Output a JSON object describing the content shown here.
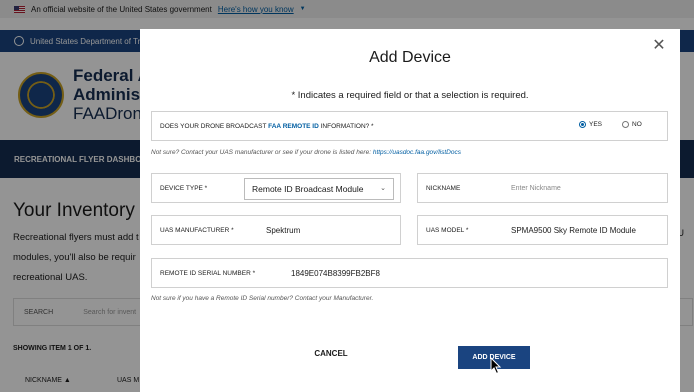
{
  "background": {
    "gov_banner": {
      "text": "An official website of the United States government",
      "link": "Here's how you know"
    },
    "agency_bar": "United States Department of Tra",
    "header": {
      "line1": "Federal Av",
      "line2": "Administrat",
      "line3": "FAADroneZ"
    },
    "dash_bar": "RECREATIONAL FLYER DASHBOAR",
    "inventory_title": "Your Inventory",
    "inventory_text": [
      "Recreational flyers must add t",
      "modules, you'll also be requir",
      "recreational UAS."
    ],
    "search_label": "SEARCH",
    "search_placeholder": "Search for invent",
    "showing": "SHOWING ITEM 1 OF 1.",
    "col_nickname": "NICKNAME",
    "col_uas": "UAS M",
    "right_fragments": [
      "t",
      "n U",
      "ed"
    ]
  },
  "modal": {
    "title": "Add Device",
    "close_icon": "close-icon",
    "required_note": "* Indicates a required field or that a selection is required.",
    "broadcast": {
      "label_before": "DOES YOUR DRONE BROADCAST ",
      "label_link": "FAA REMOTE ID",
      "label_after": " INFORMATION? *",
      "yes": "YES",
      "no": "NO",
      "selected": "YES"
    },
    "broadcast_hint": {
      "text": "Not sure? Contact your UAS manufacturer or see if your drone is listed here: ",
      "link": "https://uasdoc.faa.gov/listDocs"
    },
    "device_type": {
      "label": "DEVICE TYPE *",
      "value": "Remote ID Broadcast Module"
    },
    "nickname": {
      "label": "NICKNAME",
      "placeholder": "Enter Nickname",
      "value": ""
    },
    "manufacturer": {
      "label": "UAS MANUFACTURER *",
      "value": "Spektrum"
    },
    "model": {
      "label": "UAS MODEL *",
      "value": "SPMA9500 Sky Remote ID Module"
    },
    "serial": {
      "label": "REMOTE ID SERIAL NUMBER *",
      "value": "1849E074B8399FB2BF8"
    },
    "serial_hint": "Not sure if you have a Remote ID Serial number? Contact your Manufacturer.",
    "cancel": "CANCEL",
    "add_device": "ADD DEVICE"
  },
  "colors": {
    "primary": "#1a4480",
    "navy": "#162e51",
    "link": "#005ea2"
  }
}
